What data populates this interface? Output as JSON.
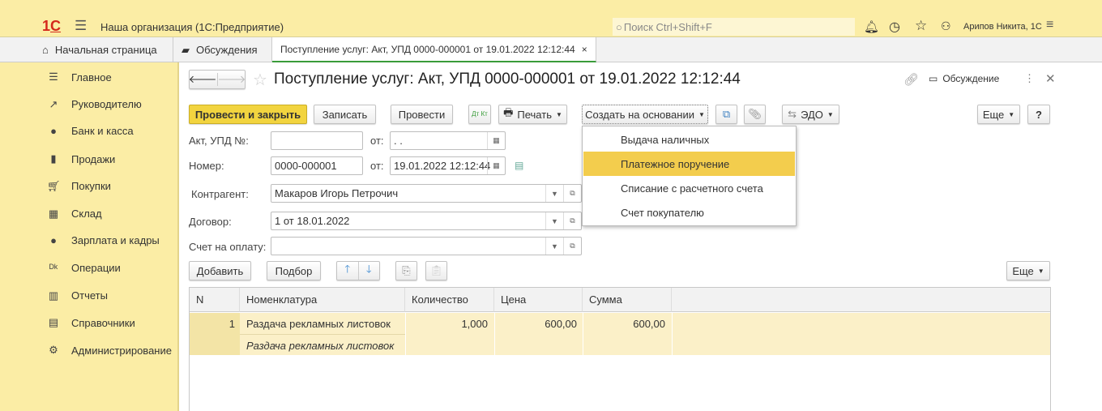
{
  "header": {
    "app_title": "Наша организация  (1С:Предприятие)",
    "search_placeholder": "Поиск Ctrl+Shift+F",
    "user": "Арипов Никита, 1С"
  },
  "tabs": [
    {
      "label": "Начальная страница"
    },
    {
      "label": "Обсуждения"
    },
    {
      "label": "Поступление услуг: Акт, УПД 0000-000001 от 19.01.2022 12:12:44",
      "active": true
    }
  ],
  "sidebar": {
    "items": [
      {
        "label": "Главное",
        "icon": "menu-icon"
      },
      {
        "label": "Руководителю",
        "icon": "trend-icon"
      },
      {
        "label": "Банк и касса",
        "icon": "ruble-icon"
      },
      {
        "label": "Продажи",
        "icon": "bag-icon"
      },
      {
        "label": "Покупки",
        "icon": "cart-icon"
      },
      {
        "label": "Склад",
        "icon": "warehouse-icon"
      },
      {
        "label": "Зарплата и кадры",
        "icon": "person-icon"
      },
      {
        "label": "Операции",
        "icon": "dt-kt-icon"
      },
      {
        "label": "Отчеты",
        "icon": "bar-chart-icon"
      },
      {
        "label": "Справочники",
        "icon": "book-icon"
      },
      {
        "label": "Администрирование",
        "icon": "gear-icon"
      }
    ]
  },
  "form": {
    "title": "Поступление услуг: Акт, УПД 0000-000001 от 19.01.2022 12:12:44",
    "discussion": "Обсуждение",
    "toolbar": {
      "post_close": "Провести и закрыть",
      "save": "Записать",
      "post": "Провести",
      "dtkt": "Дт Кт",
      "print": "Печать",
      "create_based": "Создать на основании",
      "edo": "ЭДО",
      "more": "Еще",
      "help": "?"
    },
    "fields": {
      "act_label": "Акт, УПД №:",
      "act_value": "",
      "from1": "от:",
      "act_date": " .  .",
      "number_label": "Номер:",
      "number_value": "0000-000001",
      "from2": "от:",
      "number_date": "19.01.2022 12:12:44",
      "counterparty_label": "Контрагент:",
      "counterparty_value": "Макаров Игорь Петрочич",
      "contract_label": "Договор:",
      "contract_value": "1 от 18.01.2022",
      "invoice_label": "Счет на оплату:",
      "invoice_value": ""
    },
    "table_toolbar": {
      "add": "Добавить",
      "pick": "Подбор",
      "more": "Еще"
    },
    "table": {
      "columns": [
        "N",
        "Номенклатура",
        "Количество",
        "Цена",
        "Сумма"
      ],
      "rows": [
        {
          "n": "1",
          "item": "Раздача рекламных листовок",
          "item_desc": "Раздача рекламных листовок",
          "qty": "1,000",
          "price": "600,00",
          "sum": "600,00"
        }
      ]
    }
  },
  "dropdown": {
    "items": [
      "Выдача наличных",
      "Платежное поручение",
      "Списание с расчетного счета",
      "Счет покупателю"
    ],
    "selected": 1
  },
  "colors": {
    "accent": "#f2d43f",
    "panel": "#fbeda5",
    "selected_row": "#fbf0c8"
  }
}
